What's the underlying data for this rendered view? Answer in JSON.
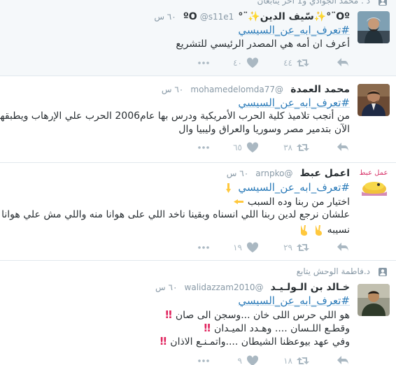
{
  "tweets": [
    {
      "context": "د . محمد الجوادي و1 آخر يتابعان",
      "name": "Oº¨°✨سّيف الدين✨¨°ºO",
      "handle": "@s11e1",
      "time": "٦٠ س",
      "hashtag": "#تعرف_ابه_عن_السيسي",
      "lines": [
        "أعرف ان أمه هي المصدر الرئيسي للتشريع"
      ],
      "retweets": "٤٤",
      "likes": "٤٠"
    },
    {
      "name": "محمد العمدة",
      "handle": "@mohamedelomda77",
      "time": "٦٠ س",
      "hashtag": "#تعرف_ابه_عن_السيسي",
      "lines": [
        "من أنجب تلاميذ كلية الحرب الأمريكية ودرس بها عام2006 الحرب علي الإرهاب ويطبقها",
        "الآن بتدمير مصر وسوريا والعراق وليبيا وال"
      ],
      "retweets": "٣٨",
      "likes": "٦٥"
    },
    {
      "name": "اعمل عبط",
      "handle": "@arnpko",
      "time": "٦٠ س",
      "hashtag": "#تعرف_ابه_عن_السيسي",
      "lines": [
        "اختيار من ربنا وده السبب",
        "علشان نرجع لدين ربنا اللي انسناه وبقينا ناخد اللي على هوانا منه واللي مش علي هوانا",
        "نسيبه"
      ],
      "retweets": "٢٩",
      "likes": "١٩",
      "avatar_text": "عمل عبط"
    },
    {
      "context": "د.فاطمة الوحش يتابع",
      "name": "خـالد بن الـولـيـد",
      "handle": "@walidazzam2010",
      "time": "٦٠ س",
      "hashtag": "#تعرف_ابه_عن_السيسي",
      "lines": [
        "هو اللي حرس اللى خان ...وسجن الى صان",
        "وقطـع اللـسان .... وهـدد الميـدان",
        "وفي عهد بيوعظنا الشيطان ....واتمـنـع الاذان"
      ],
      "retweets": "١٨",
      "likes": "٩"
    }
  ],
  "colors": {
    "link": "#2b7bb9",
    "muted": "#8899a6",
    "icon": "#aab8c2",
    "warn": "#e0245e",
    "hand": "#ffc83d"
  }
}
